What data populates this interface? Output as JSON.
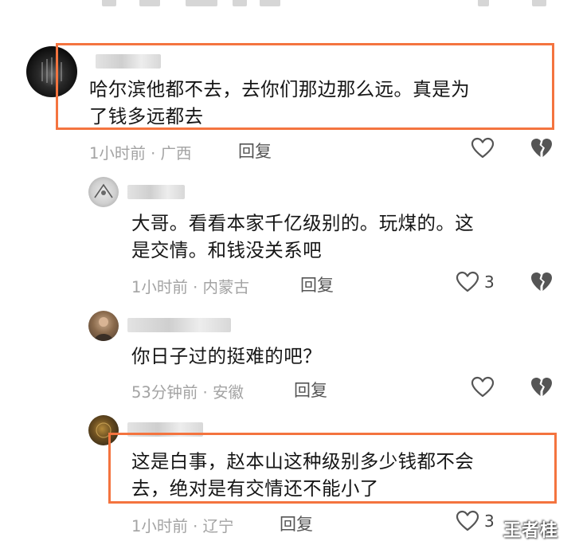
{
  "comments": [
    {
      "text_lines": [
        "哈尔滨他都不去，去你们那边那么远。真是为",
        "了钱多远都去"
      ],
      "time": "1小时前",
      "location": "广西",
      "reply_label": "回复",
      "likes": ""
    },
    {
      "text_lines": [
        "大哥。看看本家千亿级别的。玩煤的。这",
        "是交情。和钱没关系吧"
      ],
      "time": "1小时前",
      "location": "内蒙古",
      "reply_label": "回复",
      "likes": "3"
    },
    {
      "text_lines": [
        "你日子过的挺难的吧？"
      ],
      "time": "53分钟前",
      "location": "安徽",
      "reply_label": "回复",
      "likes": ""
    },
    {
      "text_lines": [
        "这是白事，赵本山这种级别多少钱都不会",
        "去，绝对是有交情还不能小了"
      ],
      "time": "1小时前",
      "location": "辽宁",
      "reply_label": "回复",
      "likes": "3"
    }
  ],
  "meta_separator": " · ",
  "watermark": "王者桂",
  "colors": {
    "highlight": "#f4743f",
    "meta_gray": "#a3a3a3",
    "icon_gray": "#555555"
  },
  "icons": [
    "heart-outline-icon",
    "broken-heart-icon"
  ]
}
